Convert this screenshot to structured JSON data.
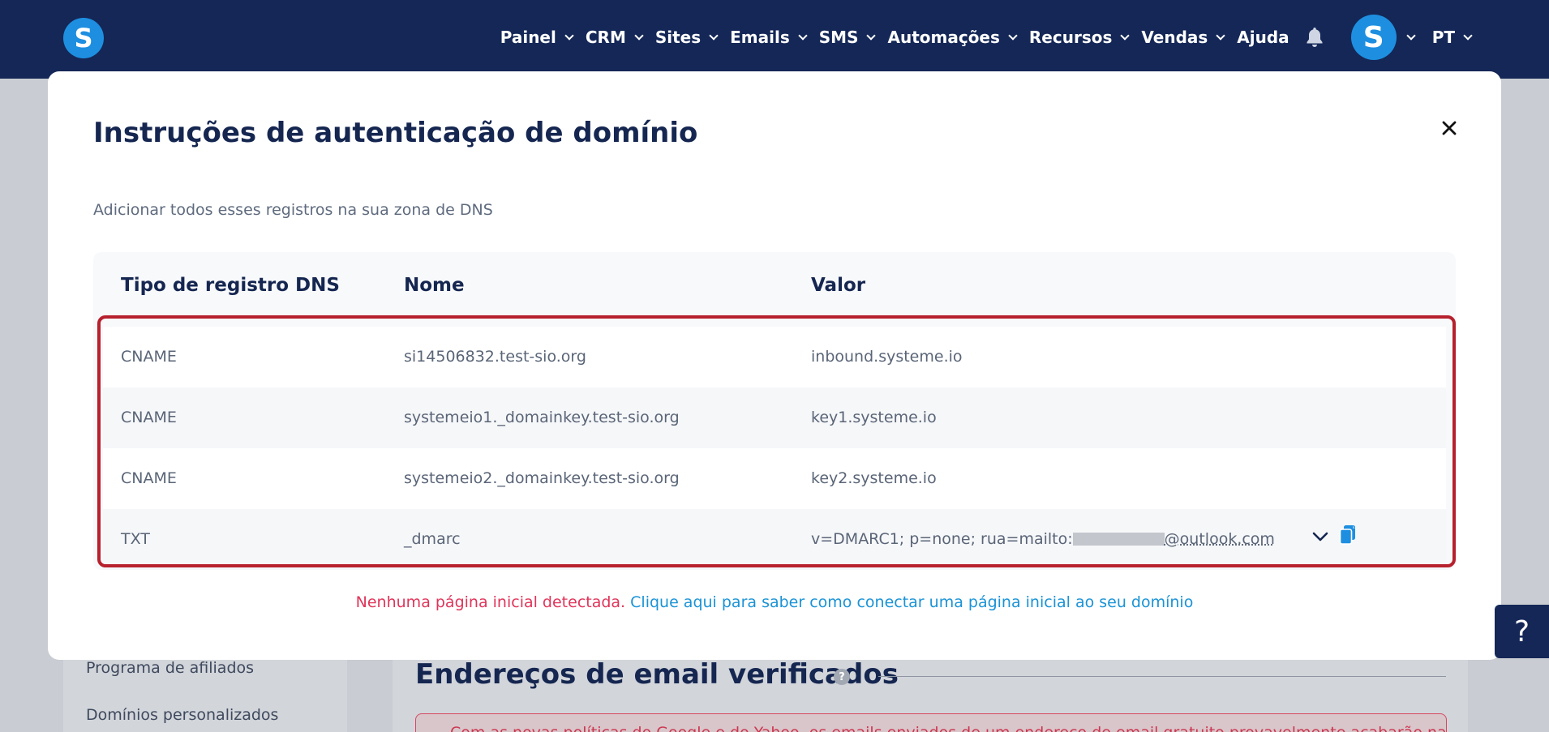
{
  "header": {
    "logo_letter": "S",
    "nav": [
      {
        "label": "Painel"
      },
      {
        "label": "CRM"
      },
      {
        "label": "Sites"
      },
      {
        "label": "Emails"
      },
      {
        "label": "SMS"
      },
      {
        "label": "Automações"
      },
      {
        "label": "Recursos"
      },
      {
        "label": "Vendas"
      }
    ],
    "help_label": "Ajuda",
    "avatar_letter": "S",
    "language": "PT",
    "bell_icon": "bell-icon"
  },
  "modal": {
    "title": "Instruções de autenticação de domínio",
    "subtitle": "Adicionar todos esses registros na sua zona de DNS",
    "close_icon": "close-icon",
    "columns": [
      "Tipo de registro DNS",
      "Nome",
      "Valor"
    ],
    "rows": [
      {
        "type": "CNAME",
        "name": "si14506832.test-sio.org",
        "value": "inbound.systeme.io"
      },
      {
        "type": "CNAME",
        "name": "systemeio1._domainkey.test-sio.org",
        "value": "key1.systeme.io"
      },
      {
        "type": "CNAME",
        "name": "systemeio2._domainkey.test-sio.org",
        "value": "key2.systeme.io"
      },
      {
        "type": "TXT",
        "name": "_dmarc",
        "value_prefix": "v=DMARC1; p=none; rua=mailto:",
        "value_email_domain": "@outlook.com"
      }
    ],
    "notice_warning": "Nenhuma página inicial detectada.",
    "notice_link": "Clique aqui para saber como conectar uma página inicial ao seu domínio"
  },
  "background": {
    "sidebar_items": [
      "Programa de afiliados",
      "Domínios personalizados"
    ],
    "section_title": "Endereços de email verificados",
    "section_help": "?",
    "alert_text": "Com as novas políticas do Google e do Yahoo, os emails enviados de um endereço de email gratuito provavelmente acabarão na"
  },
  "help_button": "?",
  "colors": {
    "nav_bg": "#142757",
    "brand_blue": "#1e8fe0",
    "highlight_border": "#b6212d",
    "warning_text": "#e0355a",
    "link_text": "#1a93d6"
  }
}
